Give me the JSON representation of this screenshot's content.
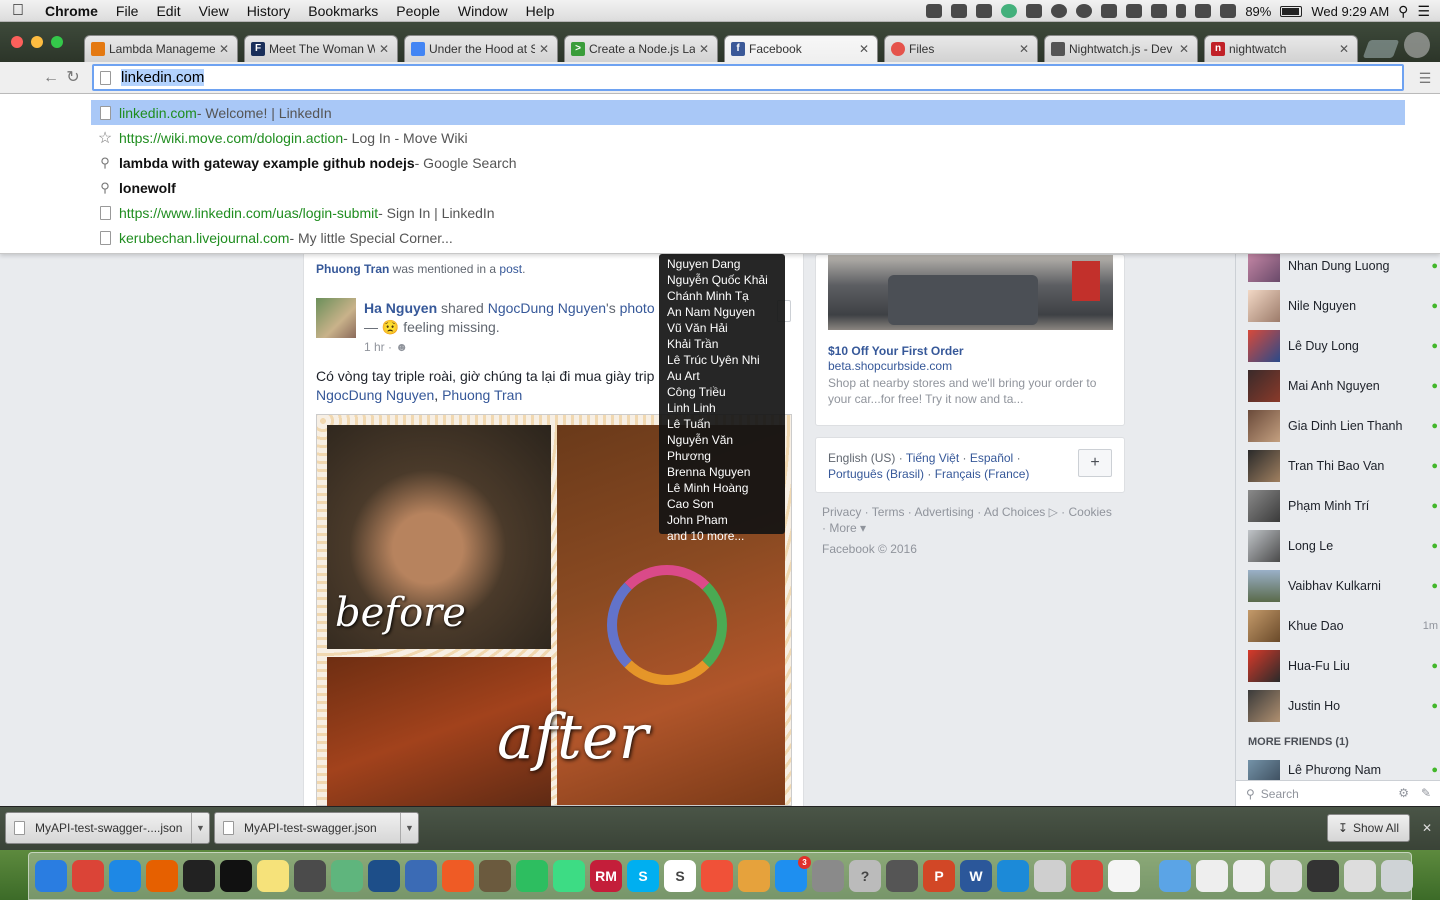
{
  "menubar": {
    "app": "Chrome",
    "items": [
      "File",
      "Edit",
      "View",
      "History",
      "Bookmarks",
      "People",
      "Window",
      "Help"
    ],
    "battery": "89%",
    "clock": "Wed 9:29 AM"
  },
  "tabs": [
    {
      "label": "Lambda Manageme",
      "icon": "lambda-icon",
      "color": "#e47911"
    },
    {
      "label": "Meet The Woman W",
      "icon": "forbes-icon",
      "color": "#1a2f5a",
      "glyph": "F"
    },
    {
      "label": "Under the Hood at S",
      "icon": "google-icon",
      "color": "#4285f4"
    },
    {
      "label": "Create a Node.js La",
      "icon": "terminal-icon",
      "color": "#3a9d3a",
      "glyph": ">"
    },
    {
      "label": "Facebook",
      "icon": "facebook-icon",
      "color": "#3b5998",
      "glyph": "f"
    },
    {
      "label": "Files",
      "icon": "files-icon",
      "color": "#e5534b"
    },
    {
      "label": "Nightwatch.js - Dev",
      "icon": "owl-icon",
      "color": "#555"
    },
    {
      "label": "nightwatch",
      "icon": "npm-icon",
      "color": "#c12127",
      "glyph": "n"
    }
  ],
  "omnibox": {
    "value": "linkedin.com"
  },
  "suggestions": [
    {
      "url": "linkedin.com",
      "title": " - Welcome! | LinkedIn",
      "type": "page"
    },
    {
      "url": "https://wiki.move.com/dologin.action",
      "title": " - Log In - Move Wiki",
      "type": "bookmark"
    },
    {
      "query": "lambda with gateway example github nodejs",
      "title": " - Google Search",
      "type": "search"
    },
    {
      "query": "lonewolf",
      "title": "",
      "type": "search"
    },
    {
      "url": "https://www.linkedin.com/uas/login-submit",
      "title": " - Sign In | LinkedIn",
      "type": "page"
    },
    {
      "url": "kerubechan.livejournal.com",
      "title": " - My little Special Corner...",
      "type": "page"
    }
  ],
  "feed": {
    "mention": {
      "name": "Phuong Tran",
      "text": " was mentioned in a ",
      "link": "post",
      "end": "."
    },
    "post": {
      "author": "Ha Nguyen",
      "action": " shared ",
      "shared_from": "NgocDung Nguyen",
      "suffix": "'s ",
      "object": "photo",
      "feeling": "— 😟 feeling missing.",
      "time": "1 hr ·",
      "body": "Có vòng tay triple roài, giờ chúng ta lại đi mua giày trip",
      "tag1": "NgocDung Nguyen",
      "tag_sep": ", ",
      "tag2": "Phuong Tran",
      "photo_text_before": "before",
      "photo_text_after": "after"
    }
  },
  "tooltip": {
    "names": [
      "Nguyen Dang",
      "Nguyễn Quốc Khải",
      "Chánh Minh Tạ",
      "An Nam Nguyen",
      "Vũ Văn Hải",
      "Khải Trần",
      "Lê Trúc Uyên Nhi",
      "Au Art",
      "Công Triều",
      "Linh Linh",
      "Lê Tuấn",
      "Nguyễn Văn Phương",
      "Brenna Nguyen",
      "Lê Minh Hoàng",
      "Cao Son",
      "John Pham"
    ],
    "more": "and 10 more..."
  },
  "ad": {
    "title": "$10 Off Your First Order",
    "domain": "beta.shopcurbside.com",
    "body": "Shop at nearby stores and we'll bring your order to your car...for free! Try it now and ta..."
  },
  "languages": {
    "current": "English (US) · ",
    "links": [
      "Tiếng Việt",
      "Español",
      "Português (Brasil)",
      "Français (France)"
    ],
    "sep": " · ",
    "add_label": "+"
  },
  "footer": {
    "links": [
      "Privacy",
      "Terms",
      "Advertising",
      "Ad Choices",
      "Cookies",
      "More"
    ],
    "copyright": "Facebook © 2016"
  },
  "chat": {
    "friends": [
      {
        "name": "Nhan Dung Luong",
        "status": "online"
      },
      {
        "name": "Nile Nguyen",
        "status": "online"
      },
      {
        "name": "Lê Duy Long",
        "status": "online"
      },
      {
        "name": "Mai Anh Nguyen",
        "status": "online"
      },
      {
        "name": "Gia Dinh Lien Thanh",
        "status": "online"
      },
      {
        "name": "Tran Thi Bao Van",
        "status": "online"
      },
      {
        "name": "Phạm Minh Trí",
        "status": "online"
      },
      {
        "name": "Long Le",
        "status": "online"
      },
      {
        "name": "Vaibhav Kulkarni",
        "status": "online"
      },
      {
        "name": "Khue Dao",
        "status": "1m"
      },
      {
        "name": "Hua-Fu Liu",
        "status": "online"
      },
      {
        "name": "Justin Ho",
        "status": "online"
      }
    ],
    "more_header": "MORE FRIENDS (1)",
    "more_friend": "Lê Phương Nam",
    "search_placeholder": "Search"
  },
  "downloads": {
    "items": [
      "MyAPI-test-swagger-....json",
      "MyAPI-test-swagger.json"
    ],
    "show_all": "Show All"
  },
  "dock": {
    "apps": [
      {
        "icon": "finder-icon",
        "color": "#2a7de1"
      },
      {
        "icon": "chrome-icon",
        "color": "#db4437"
      },
      {
        "icon": "safari-icon",
        "color": "#1e88e5"
      },
      {
        "icon": "firefox-icon",
        "color": "#e66000"
      },
      {
        "icon": "terminal-icon",
        "color": "#222"
      },
      {
        "icon": "iterm-icon",
        "color": "#111"
      },
      {
        "icon": "notes-icon",
        "color": "#f6e27a"
      },
      {
        "icon": "sublime-icon",
        "color": "#4b4b4b"
      },
      {
        "icon": "atom-icon",
        "color": "#5fb57d"
      },
      {
        "icon": "sourcetree-icon",
        "color": "#1d4e89"
      },
      {
        "icon": "virtualbox-icon",
        "color": "#3b6bb5"
      },
      {
        "icon": "postman-icon",
        "color": "#ef5b25"
      },
      {
        "icon": "tools-icon",
        "color": "#6b5a3e"
      },
      {
        "icon": "evernote-icon",
        "color": "#2dbe60"
      },
      {
        "icon": "android-studio-icon",
        "color": "#3ddc84"
      },
      {
        "icon": "rubymine-icon",
        "color": "#c41e3a",
        "glyph": "RM"
      },
      {
        "icon": "skype-icon",
        "color": "#00aff0",
        "glyph": "S"
      },
      {
        "icon": "slack-icon",
        "color": "#fff",
        "glyph": "S"
      },
      {
        "icon": "swift-icon",
        "color": "#f05138"
      },
      {
        "icon": "sequel-icon",
        "color": "#e6a23c"
      },
      {
        "icon": "app-store-icon",
        "color": "#1e8ff0",
        "badge": "3"
      },
      {
        "icon": "system-prefs-icon",
        "color": "#8a8a8a"
      },
      {
        "icon": "help-icon",
        "color": "#bbb",
        "glyph": "?"
      },
      {
        "icon": "calculator-icon",
        "color": "#555"
      },
      {
        "icon": "powerpoint-icon",
        "color": "#d24726",
        "glyph": "P"
      },
      {
        "icon": "word-icon",
        "color": "#2b579a",
        "glyph": "W"
      },
      {
        "icon": "xcode-icon",
        "color": "#1c8ad8"
      },
      {
        "icon": "printer-icon",
        "color": "#cfcfcf"
      },
      {
        "icon": "chrome-icon-2",
        "color": "#db4437"
      },
      {
        "icon": "java-icon",
        "color": "#f5f5f5"
      },
      {
        "icon": "folder-icon",
        "color": "#5ba4e6"
      },
      {
        "icon": "window-thumb-icon",
        "color": "#eee"
      },
      {
        "icon": "window-thumb-icon-2",
        "color": "#eee"
      },
      {
        "icon": "preview-icon",
        "color": "#ddd"
      },
      {
        "icon": "terminal-thumb-icon",
        "color": "#333"
      },
      {
        "icon": "window-thumb-icon-3",
        "color": "#ddd"
      },
      {
        "icon": "trash-icon",
        "color": "#cfd3d6"
      }
    ]
  }
}
